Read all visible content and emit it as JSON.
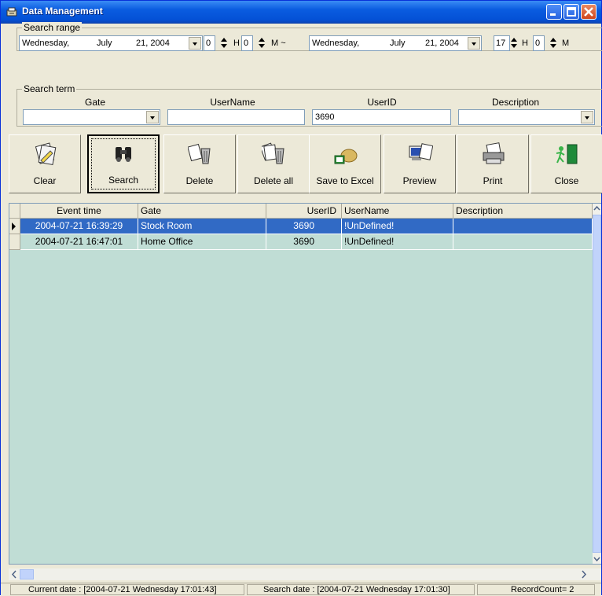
{
  "window": {
    "title": "Data Management"
  },
  "search_range": {
    "label": "Search range",
    "from": {
      "weekday": "Wednesday,",
      "month": "July",
      "day_year": "21, 2004",
      "hour": "0",
      "minute": "0"
    },
    "separator": "M ~",
    "to": {
      "weekday": "Wednesday,",
      "month": "July",
      "day_year": "21, 2004",
      "hour": "17",
      "minute": "0"
    },
    "hour_unit": "H",
    "minute_unit": "M"
  },
  "search_term": {
    "label": "Search term",
    "gate_label": "Gate",
    "gate_value": "",
    "username_label": "UserName",
    "username_value": "",
    "userid_label": "UserID",
    "userid_value": "3690",
    "description_label": "Description",
    "description_value": ""
  },
  "toolbar": {
    "clear": "Clear",
    "search": "Search",
    "delete": "Delete",
    "delete_all": "Delete all",
    "save_excel": "Save to Excel",
    "preview": "Preview",
    "print": "Print",
    "close": "Close"
  },
  "grid": {
    "columns": [
      "Event time",
      "Gate",
      "UserID",
      "UserName",
      "Description"
    ],
    "rows": [
      {
        "event_time": "2004-07-21 16:39:29",
        "gate": "Stock Room",
        "userid": "3690",
        "username": "!UnDefined!",
        "description": "",
        "selected": true
      },
      {
        "event_time": "2004-07-21 16:47:01",
        "gate": "Home Office",
        "userid": "3690",
        "username": "!UnDefined!",
        "description": "",
        "selected": false
      }
    ]
  },
  "status": {
    "current_date": "Current date : [2004-07-21 Wednesday 17:01:43]",
    "search_date": "Search date : [2004-07-21 Wednesday 17:01:30]",
    "record_count": "RecordCount= 2"
  },
  "colors": {
    "titlebar": "#0a5ce0",
    "grid_background": "#c0ddd5",
    "selected_row": "#316ac5"
  }
}
